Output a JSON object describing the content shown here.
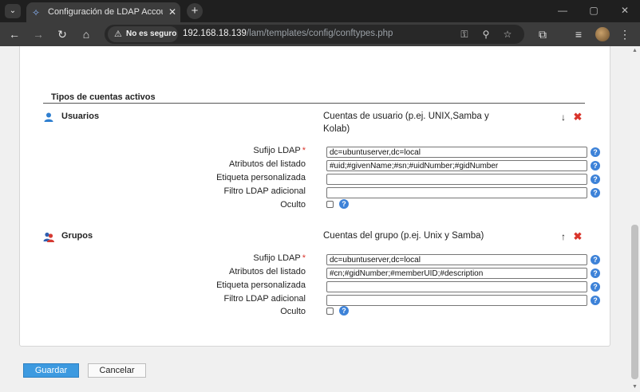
{
  "browser": {
    "tab_title": "Configuración de LDAP Accoun",
    "security_label": "No es seguro",
    "url_host": "192.168.18.139",
    "url_path": "/lam/templates/config/conftypes.php"
  },
  "page": {
    "section_title": "Tipos de cuentas activos",
    "accounts": [
      {
        "name": "Usuarios",
        "icon": "user-icon",
        "description": "Cuentas de usuario (p.ej. UNIX,Samba y Kolab)",
        "move_icon": "arrow-down-icon",
        "fields": {
          "suffix_label": "Sufijo LDAP",
          "suffix_value": "dc=ubuntuserver,dc=local",
          "list_attrs_label": "Atributos del listado",
          "list_attrs_value": "#uid;#givenName;#sn;#uidNumber;#gidNumber",
          "custom_label_label": "Etiqueta personalizada",
          "custom_label_value": "",
          "filter_label": "Filtro LDAP adicional",
          "filter_value": "",
          "hidden_label": "Oculto",
          "hidden_checked": false
        }
      },
      {
        "name": "Grupos",
        "icon": "group-icon",
        "description": "Cuentas del grupo (p.ej. Unix y Samba)",
        "move_icon": "arrow-up-icon",
        "fields": {
          "suffix_label": "Sufijo LDAP",
          "suffix_value": "dc=ubuntuserver,dc=local",
          "list_attrs_label": "Atributos del listado",
          "list_attrs_value": "#cn;#gidNumber;#memberUID;#description",
          "custom_label_label": "Etiqueta personalizada",
          "custom_label_value": "",
          "filter_label": "Filtro LDAP adicional",
          "filter_value": "",
          "hidden_label": "Oculto",
          "hidden_checked": false
        }
      }
    ],
    "required_mark": "*",
    "help_glyph": "?",
    "delete_glyph": "✖"
  },
  "actions": {
    "save_label": "Guardar",
    "cancel_label": "Cancelar"
  },
  "colors": {
    "help": "#3d82d8",
    "delete": "#d9342b",
    "save_button": "#3d9ae0"
  }
}
